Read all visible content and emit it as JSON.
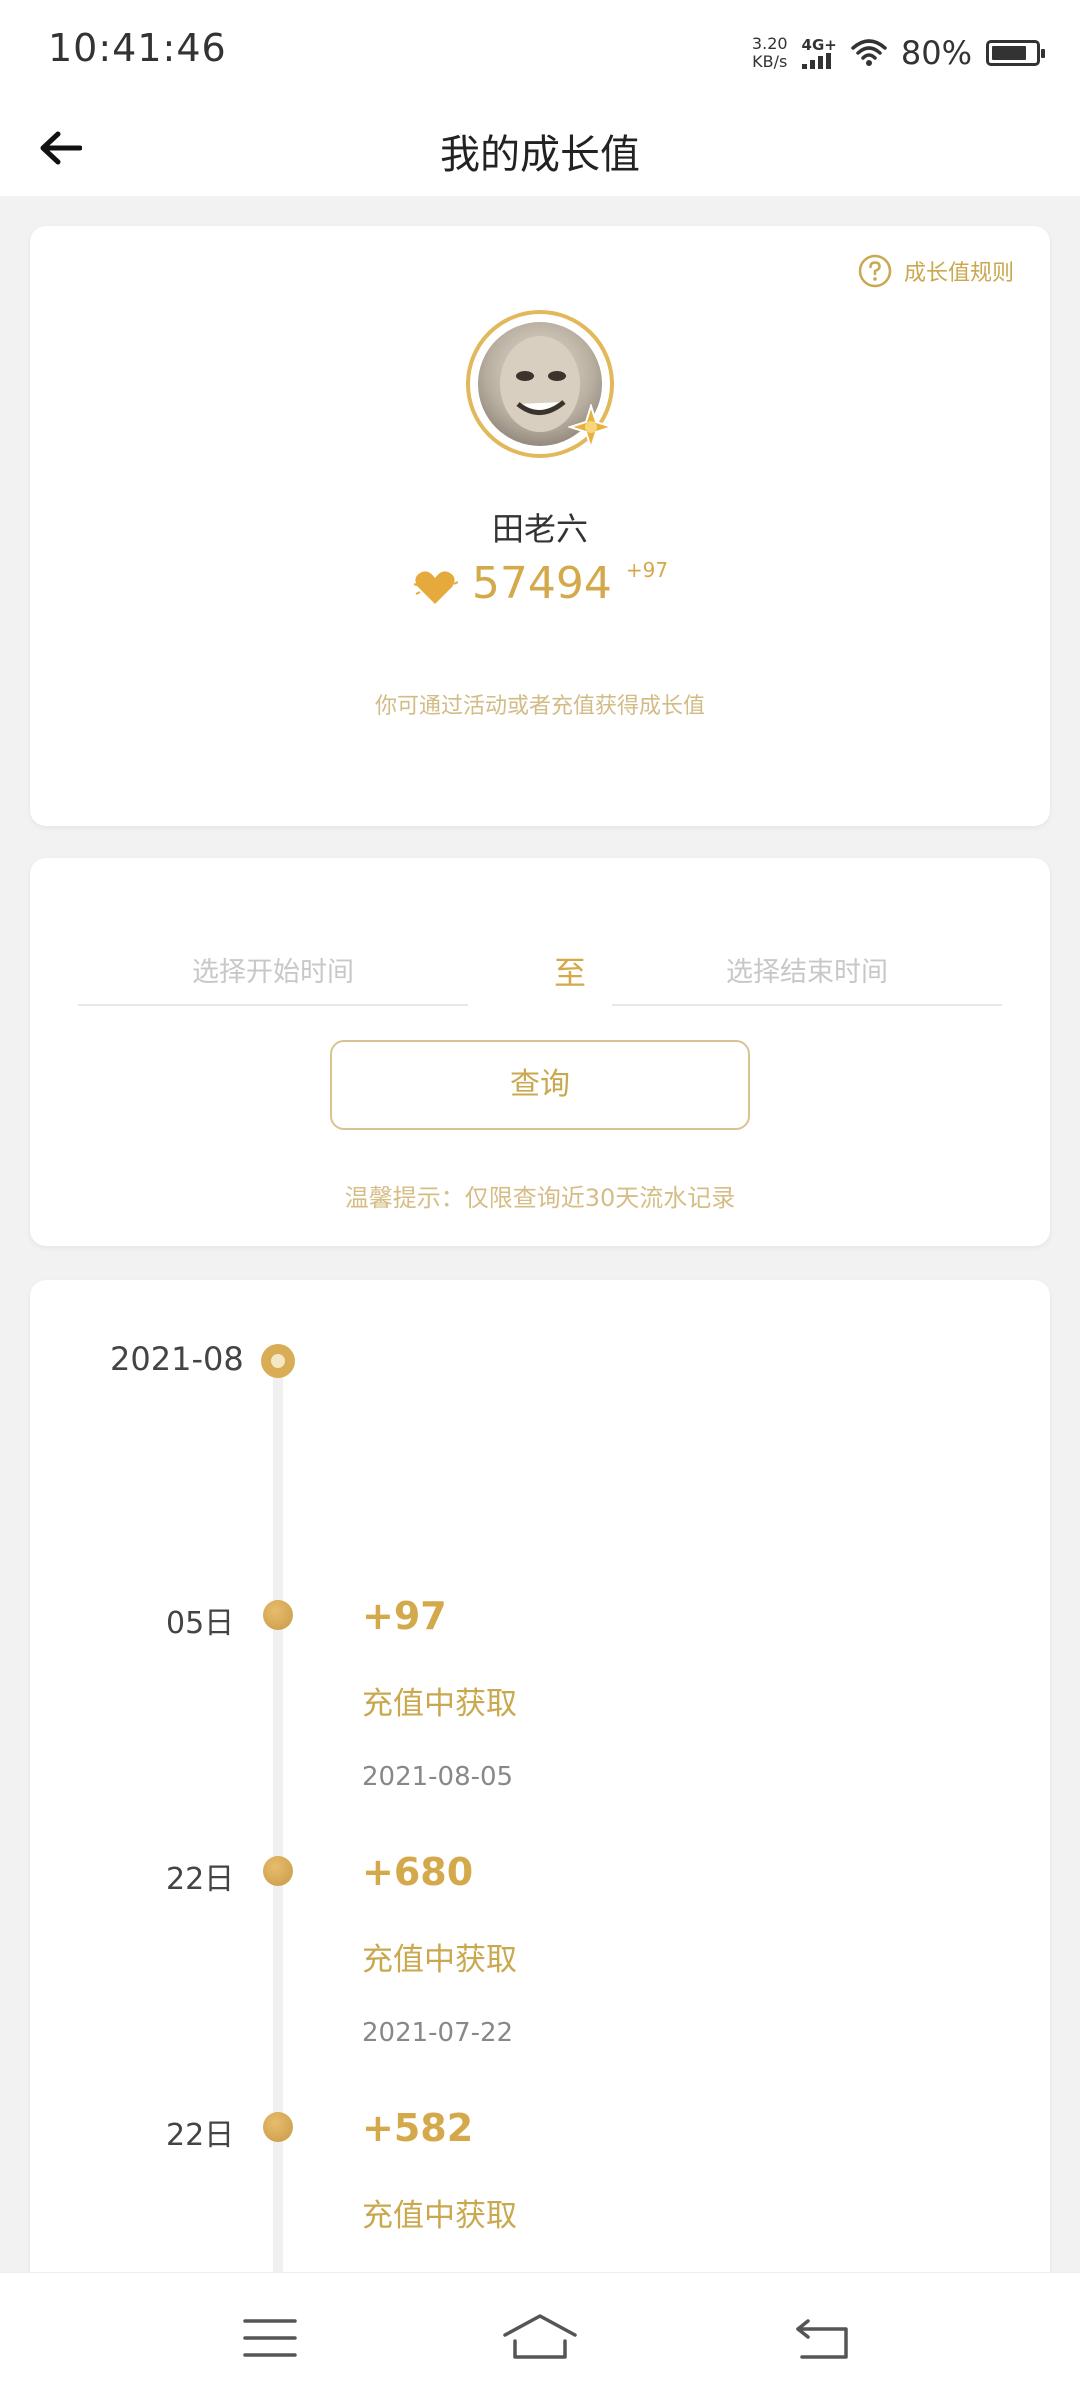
{
  "status_bar": {
    "time": "10:41:46",
    "net_speed_value": "3.20",
    "net_speed_unit": "KB/s",
    "network_type": "4G+",
    "battery_percent": "80%",
    "battery_level": 0.8
  },
  "header": {
    "title": "我的成长值"
  },
  "profile": {
    "rules_link": "成长值规则",
    "user_name": "田老六",
    "growth_points": "57494",
    "points_delta": "+97",
    "hint": "你可通过活动或者充值获得成长值"
  },
  "query": {
    "start_placeholder": "选择开始时间",
    "separator": "至",
    "end_placeholder": "选择结束时间",
    "button_label": "查询",
    "tip": "温馨提示：仅限查询近30天流水记录"
  },
  "timeline": {
    "month": "2021-08",
    "entries": [
      {
        "day": "05日",
        "amount": "+97",
        "source": "充值中获取",
        "date": "2021-08-05"
      },
      {
        "day": "22日",
        "amount": "+680",
        "source": "充值中获取",
        "date": "2021-07-22"
      },
      {
        "day": "22日",
        "amount": "+582",
        "source": "充值中获取",
        "date": ""
      }
    ]
  },
  "colors": {
    "accent_gold": "#d4a94c",
    "page_bg": "#f2f2f2"
  },
  "icons": {
    "back": "arrow-left-icon",
    "rules": "question-circle-icon",
    "points": "heart-icon",
    "nav_menu": "menu-icon",
    "nav_home": "home-icon",
    "nav_back": "return-icon"
  }
}
